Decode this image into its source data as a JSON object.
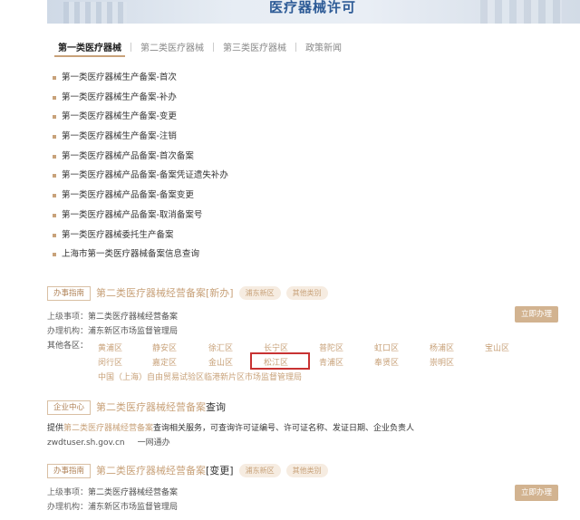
{
  "banner": {
    "title": "医疗器械许可"
  },
  "tabs": [
    {
      "label": "第一类医疗器械"
    },
    {
      "label": "第二类医疗器械"
    },
    {
      "label": "第三类医疗器械"
    },
    {
      "label": "政策新闻"
    }
  ],
  "class1_items": [
    "第一类医疗器械生产备案-首次",
    "第一类医疗器械生产备案-补办",
    "第一类医疗器械生产备案-变更",
    "第一类医疗器械生产备案-注销",
    "第一类医疗器械产品备案-首次备案",
    "第一类医疗器械产品备案-备案凭证遗失补办",
    "第一类医疗器械产品备案-备案变更",
    "第一类医疗器械产品备案-取消备案号",
    "第一类医疗器械委托生产备案",
    "上海市第一类医疗器械备案信息查询"
  ],
  "section1": {
    "tag": "办事指南",
    "title": "第二类医疗器械经营备案",
    "bracket": "[新办]",
    "pills": [
      "浦东新区",
      "其他类别"
    ],
    "parent_label": "上级事项：",
    "parent_value": "第二类医疗器械经营备案",
    "org_label": "办理机构：",
    "org_value": "浦东新区市场监督管理局",
    "other_label": "其他各区：",
    "button": "立即办理",
    "districts_row1": [
      "黄浦区",
      "静安区",
      "徐汇区",
      "长宁区",
      "普陀区",
      "虹口区",
      "杨浦区",
      "宝山区"
    ],
    "districts_row2": [
      "闵行区",
      "嘉定区",
      "金山区",
      "松江区",
      "青浦区",
      "奉贤区",
      "崇明区"
    ],
    "districts_row3": "中国（上海）自由贸易试验区临港新片区市场监督管理局"
  },
  "section2": {
    "tag": "企业中心",
    "title": "第二类医疗器械经营备案",
    "suffix": "查询",
    "desc_prefix": "提供",
    "desc_highlight": "第二类医疗器械经营备案",
    "desc_suffix": "查询相关服务，可查询许可证编号、许可证名称、发证日期、企业负责人",
    "url": "zwdtuser.sh.gov.cn",
    "source": "一网通办"
  },
  "section3": {
    "tag": "办事指南",
    "title": "第二类医疗器械经营备案",
    "bracket": "[变更]",
    "pills": [
      "浦东新区",
      "其他类别"
    ],
    "parent_label": "上级事项：",
    "parent_value": "第二类医疗器械经营备案",
    "org_label": "办理机构：",
    "org_value": "浦东新区市场监督管理局",
    "button": "立即办理"
  },
  "colors": {
    "accent": "#c8a27a",
    "highlight_border": "#c83232",
    "banner_title": "#2d5b96"
  }
}
